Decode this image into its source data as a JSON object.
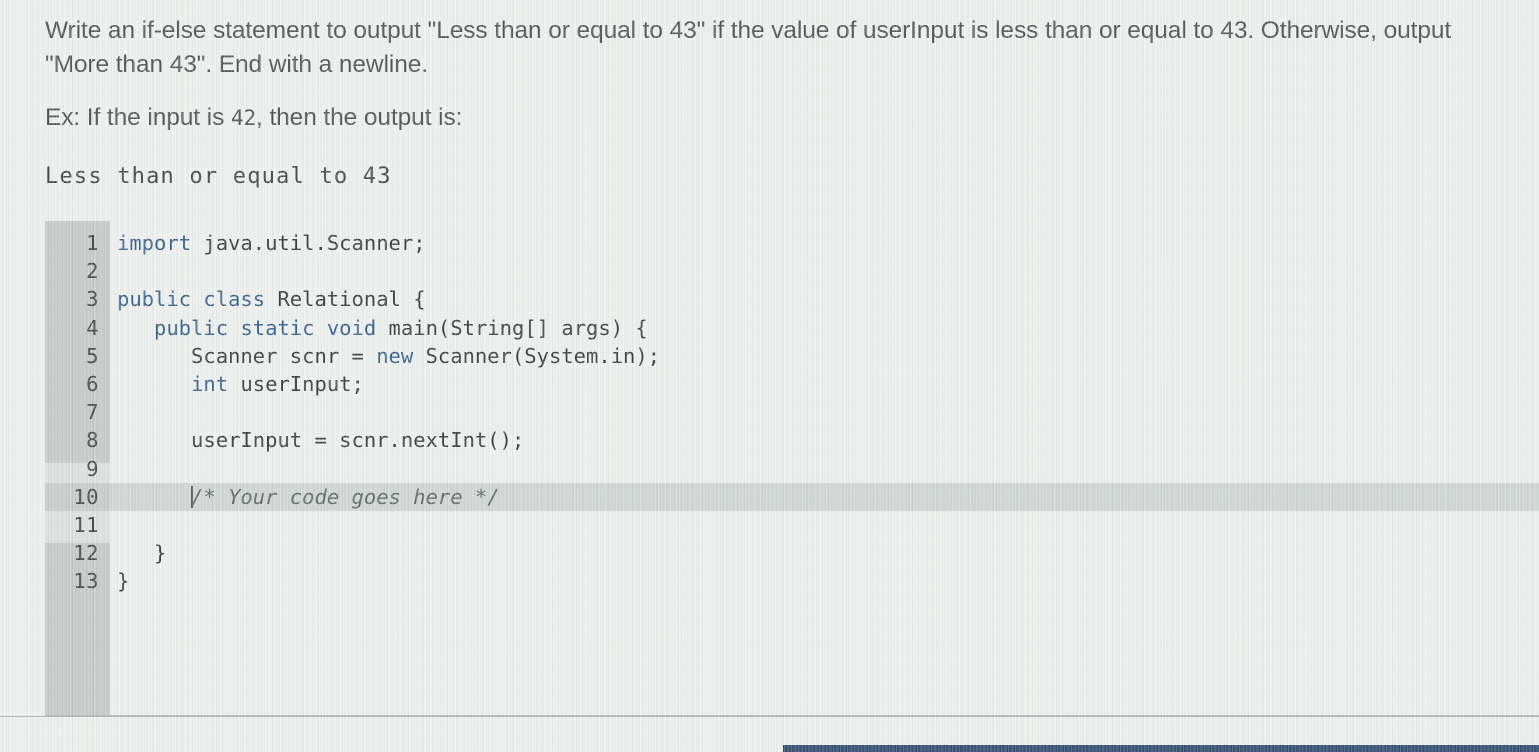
{
  "prompt": {
    "paragraph_1": "Write an if-else statement to output \"Less than or equal to 43\" if the value of userInput is less than or equal to 43. Otherwise, output \"More than 43\". End with a newline.",
    "example_lead": "Ex: If the input is ",
    "example_value": "42",
    "example_tail": ", then the output is:",
    "sample_output": "Less than or equal to 43"
  },
  "editor": {
    "language": "java",
    "active_line": 10,
    "readonly_regions": "lines 1-8 and 12-13",
    "lines": [
      {
        "number": "1",
        "tokens": [
          {
            "t": "import",
            "c": "kw"
          },
          {
            "t": " java.util.Scanner;",
            "c": "id"
          }
        ]
      },
      {
        "number": "2",
        "tokens": [
          {
            "t": "",
            "c": "id"
          }
        ]
      },
      {
        "number": "3",
        "tokens": [
          {
            "t": "public",
            "c": "kw"
          },
          {
            "t": " ",
            "c": "id"
          },
          {
            "t": "class",
            "c": "kw"
          },
          {
            "t": " Relational {",
            "c": "id"
          }
        ]
      },
      {
        "number": "4",
        "tokens": [
          {
            "t": "   ",
            "c": "id"
          },
          {
            "t": "public",
            "c": "kw"
          },
          {
            "t": " ",
            "c": "id"
          },
          {
            "t": "static",
            "c": "kw"
          },
          {
            "t": " ",
            "c": "id"
          },
          {
            "t": "void",
            "c": "kw"
          },
          {
            "t": " main(String[] args) {",
            "c": "id"
          }
        ]
      },
      {
        "number": "5",
        "tokens": [
          {
            "t": "      Scanner scnr = ",
            "c": "id"
          },
          {
            "t": "new",
            "c": "kw"
          },
          {
            "t": " Scanner(System.in);",
            "c": "id"
          }
        ]
      },
      {
        "number": "6",
        "tokens": [
          {
            "t": "      ",
            "c": "id"
          },
          {
            "t": "int",
            "c": "kw"
          },
          {
            "t": " userInput;",
            "c": "id"
          }
        ]
      },
      {
        "number": "7",
        "tokens": [
          {
            "t": "",
            "c": "id"
          }
        ]
      },
      {
        "number": "8",
        "tokens": [
          {
            "t": "      userInput = scnr.nextInt();",
            "c": "id"
          }
        ]
      },
      {
        "number": "9",
        "tokens": [
          {
            "t": "",
            "c": "id"
          }
        ]
      },
      {
        "number": "10",
        "tokens": [
          {
            "t": "      ",
            "c": "id"
          },
          {
            "t": "/* Your code goes here */",
            "c": "cmt"
          }
        ],
        "caret_before_token": 1
      },
      {
        "number": "11",
        "tokens": [
          {
            "t": "",
            "c": "id"
          }
        ]
      },
      {
        "number": "12",
        "tokens": [
          {
            "t": "   }",
            "c": "id"
          }
        ]
      },
      {
        "number": "13",
        "tokens": [
          {
            "t": "}",
            "c": "id"
          }
        ]
      }
    ]
  },
  "colors": {
    "page_background": "#f2f3f1",
    "prompt_text": "#4c5154",
    "gutter_background": "#e2e3e1",
    "gutter_readonly": "#c9cbc9",
    "keyword": "#2f5d8c",
    "identifier": "#35393c",
    "comment": "#5e6366",
    "active_line_highlight": "#a8aeac",
    "accent_bar": "#2e4a6b"
  }
}
